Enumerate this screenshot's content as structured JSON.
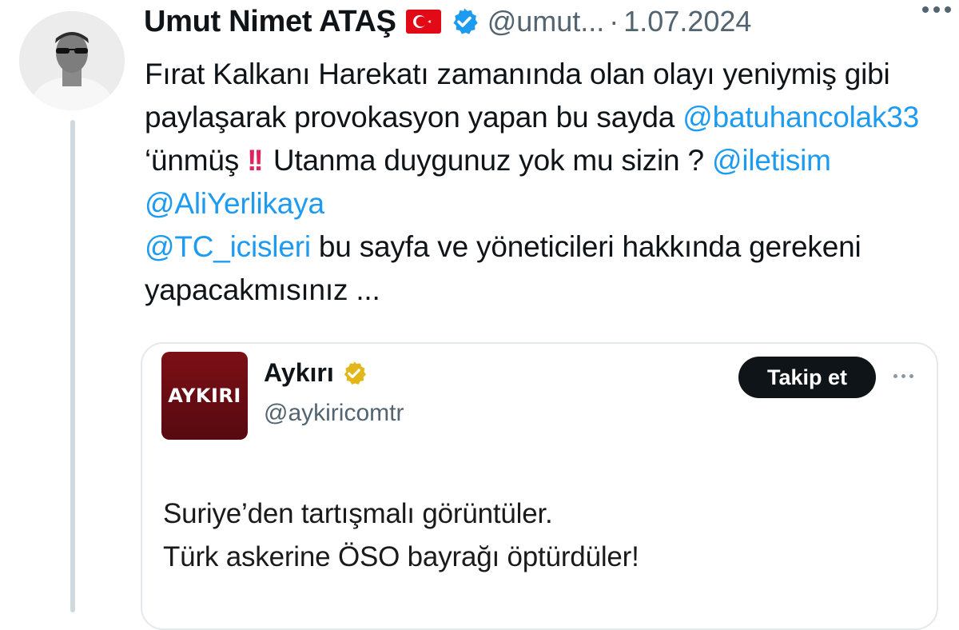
{
  "tweet": {
    "author_name": "Umut Nimet ATAŞ",
    "handle": "@umut...",
    "separator": "·",
    "date": "1.07.2024",
    "text_parts": [
      "Fırat Kalkanı Harekatı zamanında olan olayı yeniymiş gibi paylaşarak provokasyon yapan bu sayda ",
      "@batuhancolak33",
      " ‘ünmüş ",
      "!!",
      " Utanma duygunuz yok mu sizin ? ",
      "@iletisim",
      " ",
      "@AliYerlikaya",
      " ",
      "@TC_icisleri",
      " bu sayfa ve yöneticileri hakkında gerekeni yapacakmısınız ..."
    ]
  },
  "quote": {
    "logo_text": "AYKIRI",
    "name": "Aykırı",
    "handle": "@aykiricomtr",
    "follow_label": "Takip et",
    "lines": [
      "Suriye’den tartışmalı görüntüler.",
      "Türk askerine ÖSO bayrağı öptürdüler!"
    ]
  },
  "icons": {
    "flag": "turkey-flag-icon",
    "verified": "verified-badge-icon",
    "gold_verified": "gold-verified-badge-icon",
    "more": "more-icon"
  },
  "colors": {
    "mention": "#1d9bf0",
    "verified_blue": "#1d9bf0",
    "verified_gold": "#e2b719",
    "follow_button": "#0f1419",
    "logo_red": "#6e0d14"
  }
}
